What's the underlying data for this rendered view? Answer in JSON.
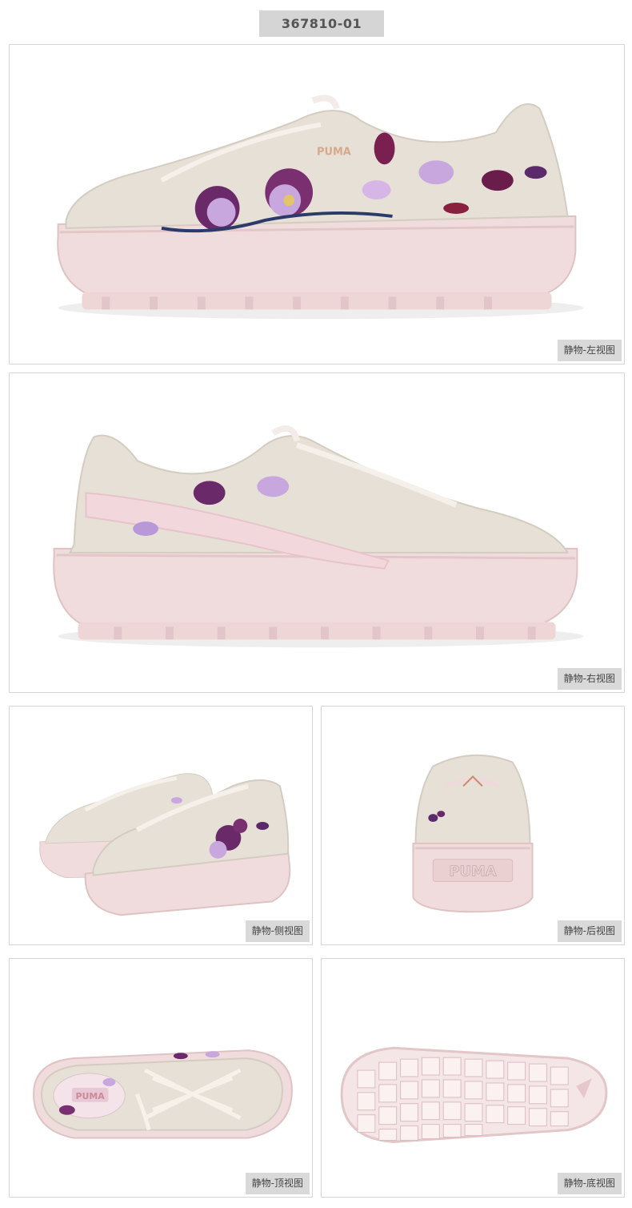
{
  "product": {
    "sku": "367810-01"
  },
  "views": [
    {
      "caption": "静物-左视图",
      "shoe_wordmark": "PUMA"
    },
    {
      "caption": "静物-右视图"
    },
    {
      "caption": "静物-侧视图"
    },
    {
      "caption": "静物-后视图",
      "heel_wordmark": "PUMA"
    },
    {
      "caption": "静物-顶视图",
      "insole_wordmark": "PUMA"
    },
    {
      "caption": "静物-底视图"
    }
  ],
  "colors": {
    "suede": "#e6e0d6",
    "sole": "#f0dcdc",
    "formstrip": "#f2d8dc",
    "embroidery_dark": "#6a2a6a",
    "embroidery_light": "#c8a6de",
    "caption_bg": "#d9d9d9"
  }
}
